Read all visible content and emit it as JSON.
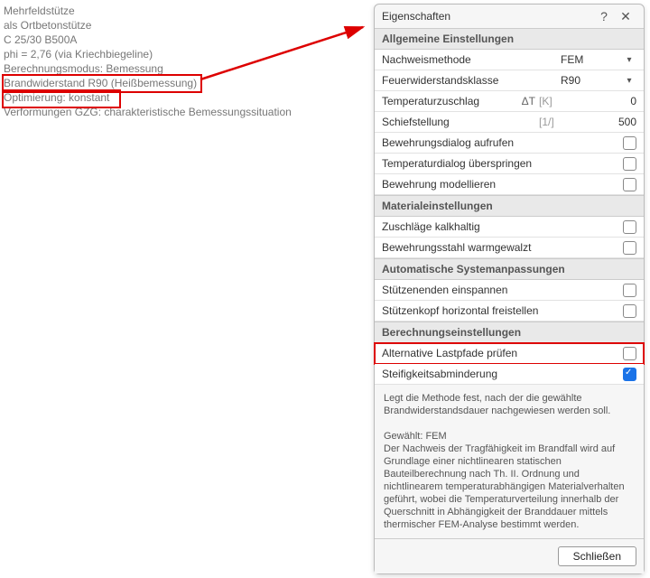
{
  "bg": {
    "l1": "Mehrfeldstütze",
    "l2": "als Ortbetonstütze",
    "l3": "C 25/30   B500A",
    "l4": "phi = 2,76 (via Kriechbiegeline)",
    "l5": "Berechnungsmodus: Bemessung",
    "l6": "Brandwiderstand R90 (Heißbemessung)",
    "l7": "Optimierung: konstant",
    "l8": "Verformungen GZG: charakteristische Bemessungssituation"
  },
  "panel": {
    "title": "Eigenschaften",
    "help": "?",
    "close_label": "Schließen"
  },
  "sec": {
    "allg": "Allgemeine Einstellungen",
    "mat": "Materialeinstellungen",
    "auto": "Automatische Systemanpassungen",
    "ber": "Berechnungseinstellungen"
  },
  "rows": {
    "nachweis": {
      "label": "Nachweismethode",
      "value": "FEM"
    },
    "feuer": {
      "label": "Feuerwiderstandsklasse",
      "value": "R90"
    },
    "temp": {
      "label": "Temperaturzuschlag",
      "sym": "ΔT",
      "unit": "[K]",
      "value": "0"
    },
    "schief": {
      "label": "Schiefstellung",
      "unit": "[1/]",
      "value": "500"
    },
    "bewdlg": {
      "label": "Bewehrungsdialog aufrufen"
    },
    "tempdlg": {
      "label": "Temperaturdialog überspringen"
    },
    "bewmodel": {
      "label": "Bewehrung modellieren"
    },
    "zuschlag": {
      "label": "Zuschläge kalkhaltig"
    },
    "bewstahl": {
      "label": "Bewehrungsstahl warmgewalzt"
    },
    "einspannen": {
      "label": "Stützenenden einspannen"
    },
    "freistell": {
      "label": "Stützenkopf horizontal freistellen"
    },
    "altlast": {
      "label": "Alternative Lastpfade prüfen"
    },
    "steif": {
      "label": "Steifigkeitsabminderung"
    }
  },
  "desc": {
    "p1": "Legt die Methode fest, nach der die gewählte Brandwiderstandsdauer nachgewiesen werden soll.",
    "p2": "Gewählt: FEM",
    "p3": "Der Nachweis der Tragfähigkeit im Brandfall wird auf Grundlage einer nichtlinearen statischen Bauteilberechnung nach Th. II. Ordnung und nichtlinearem temperaturabhängigen Materialverhalten geführt, wobei die Temperaturverteilung innerhalb der Querschnitt in Abhängigkeit der Branddauer mittels thermischer FEM-Analyse bestimmt werden."
  }
}
